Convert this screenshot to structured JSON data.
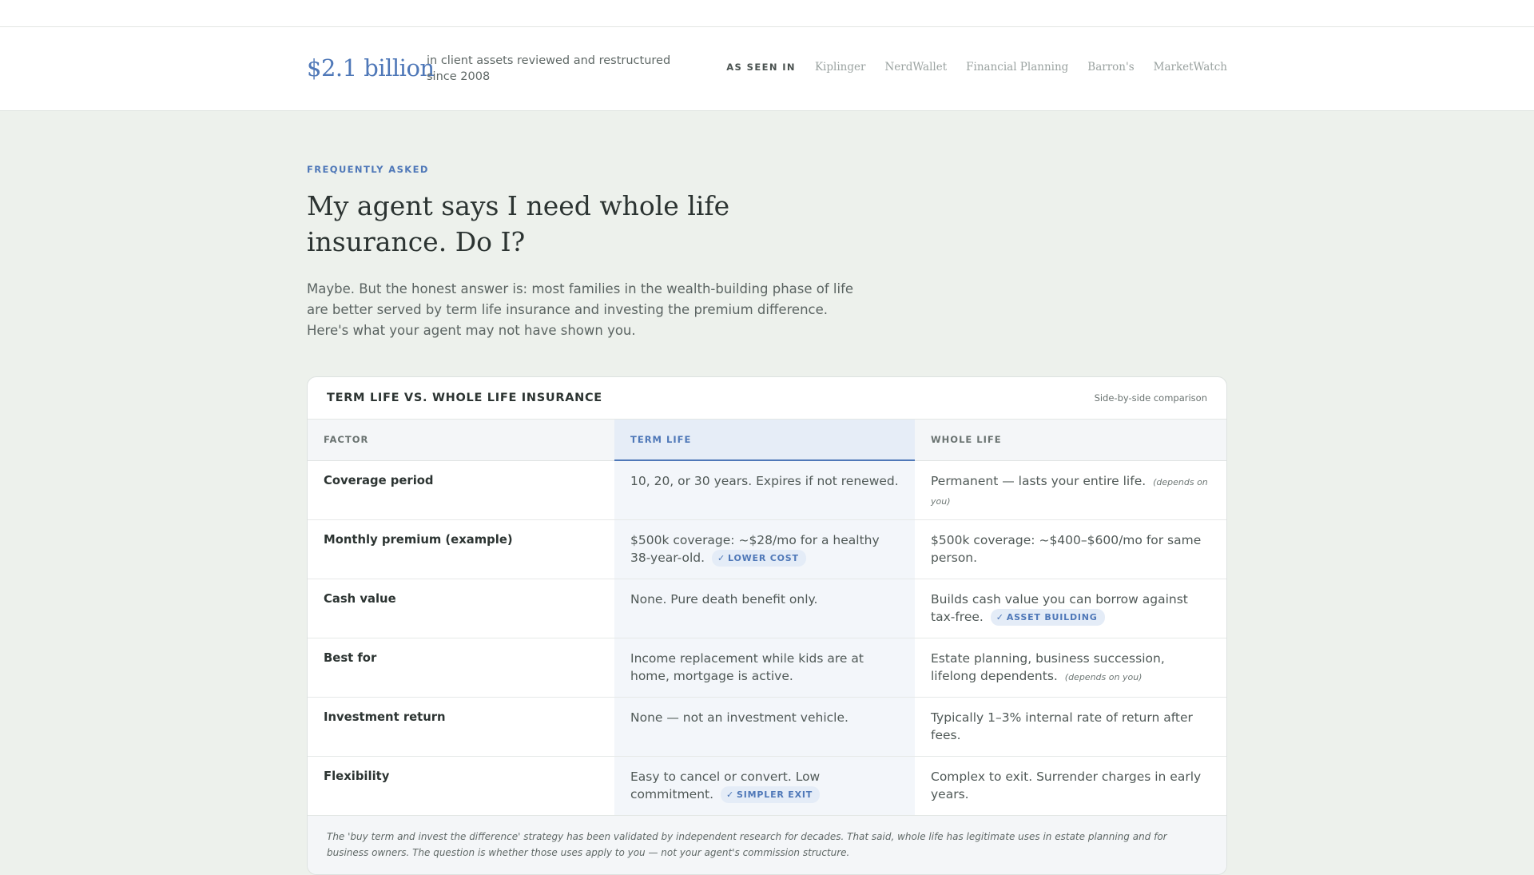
{
  "stats": {
    "amount": "$2.1 billion",
    "description": "in client assets reviewed and restructured since 2008"
  },
  "press": {
    "label": "AS SEEN IN",
    "outlets": [
      "Kiplinger",
      "NerdWallet",
      "Financial Planning",
      "Barron's",
      "MarketWatch"
    ]
  },
  "faq": {
    "eyebrow": "FREQUENTLY ASKED",
    "question": "My agent says I need whole life insurance. Do I?",
    "answer": "Maybe. But the honest answer is: most families in the wealth-building phase of life are better served by term life insurance and investing the premium difference. Here's what your agent may not have shown you."
  },
  "comparison": {
    "title": "TERM LIFE VS. WHOLE LIFE INSURANCE",
    "subtitle": "Side-by-side comparison",
    "headers": [
      "FACTOR",
      "TERM LIFE",
      "WHOLE LIFE"
    ],
    "rows": [
      {
        "factor": "Coverage period",
        "term": "10, 20, or 30 years. Expires if not renewed.",
        "term_badge": "",
        "term_note": "",
        "whole": "Permanent — lasts your entire life.",
        "whole_badge": "",
        "whole_note": "(depends on you)"
      },
      {
        "factor": "Monthly premium (example)",
        "term": "$500k coverage: ~$28/mo for a healthy 38-year-old.",
        "term_badge": "LOWER COST",
        "term_note": "",
        "whole": "$500k coverage: ~$400–$600/mo for same person.",
        "whole_badge": "",
        "whole_note": ""
      },
      {
        "factor": "Cash value",
        "term": "None. Pure death benefit only.",
        "term_badge": "",
        "term_note": "",
        "whole": "Builds cash value you can borrow against tax-free.",
        "whole_badge": "ASSET BUILDING",
        "whole_note": ""
      },
      {
        "factor": "Best for",
        "term": "Income replacement while kids are at home, mortgage is active.",
        "term_badge": "",
        "term_note": "",
        "whole": "Estate planning, business succession, lifelong dependents.",
        "whole_badge": "",
        "whole_note": "(depends on you)"
      },
      {
        "factor": "Investment return",
        "term": "None — not an investment vehicle.",
        "term_badge": "",
        "term_note": "",
        "whole": "Typically 1–3% internal rate of return after fees.",
        "whole_badge": "",
        "whole_note": ""
      },
      {
        "factor": "Flexibility",
        "term": "Easy to cancel or convert. Low commitment.",
        "term_badge": "SIMPLER EXIT",
        "term_note": "",
        "whole": "Complex to exit. Surrender charges in early years.",
        "whole_badge": "",
        "whole_note": ""
      }
    ],
    "footnote": "The 'buy term and invest the difference' strategy has been validated by independent research for decades. That said, whole life has legitimate uses in estate planning and for business owners. The question is whether those uses apply to you — not your agent's commission structure."
  },
  "icons": {
    "badge": "check-icon"
  },
  "colors": {
    "accent": "#4f78b8",
    "page_background": "#edf1ec",
    "term_column": "#f3f6fa"
  }
}
